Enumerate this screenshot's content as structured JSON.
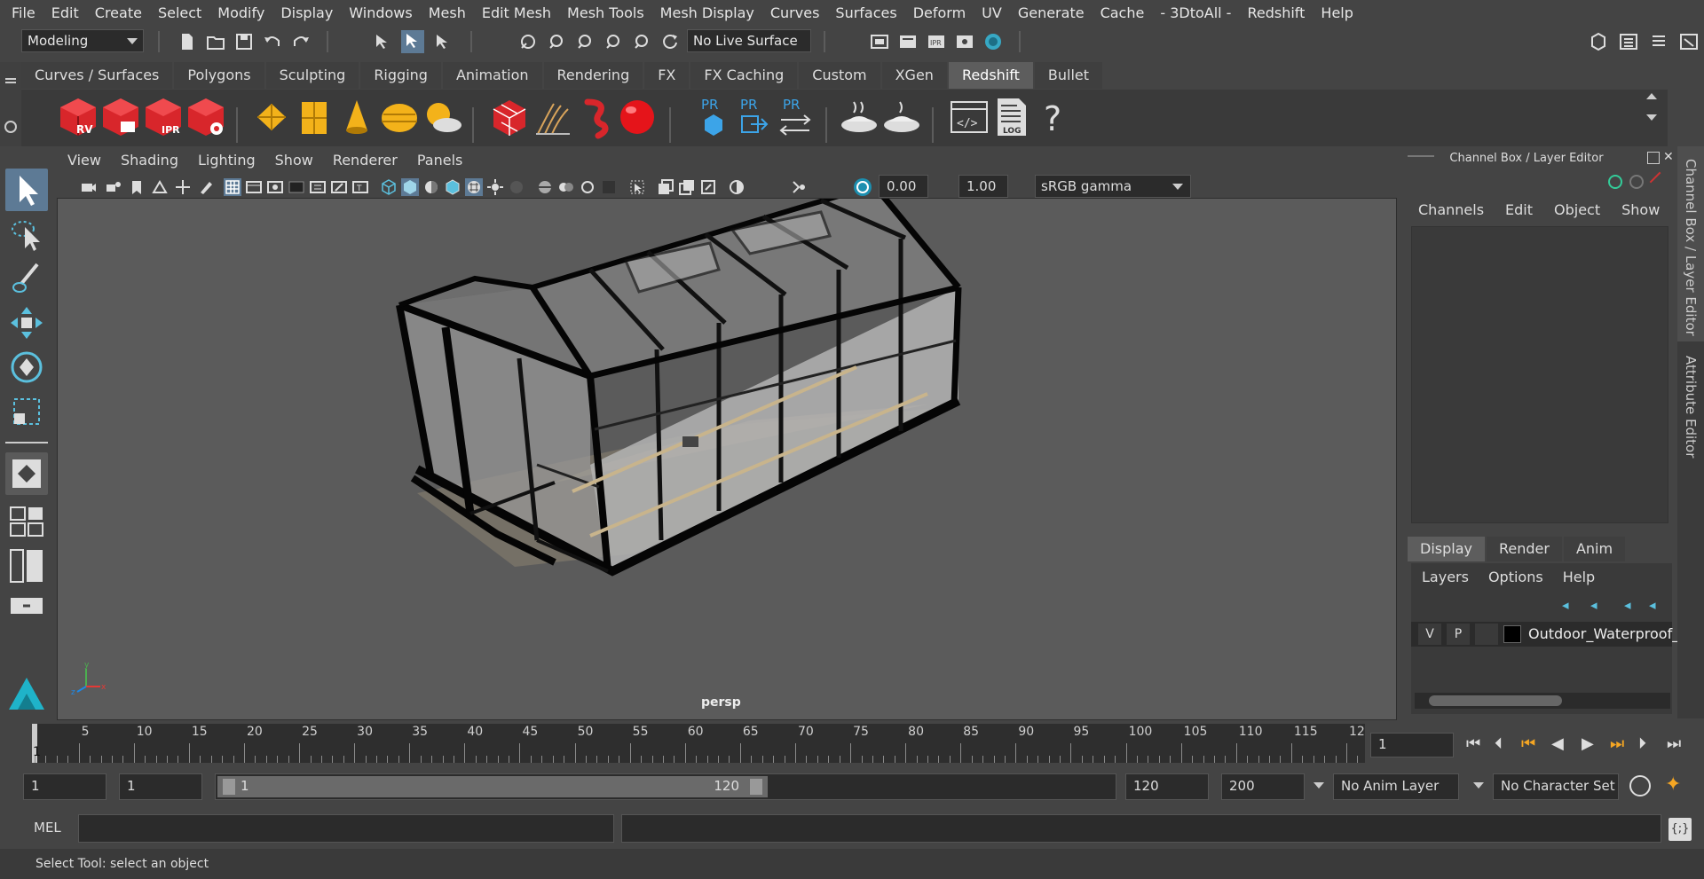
{
  "menubar": [
    "File",
    "Edit",
    "Create",
    "Select",
    "Modify",
    "Display",
    "Windows",
    "Mesh",
    "Edit Mesh",
    "Mesh Tools",
    "Mesh Display",
    "Curves",
    "Surfaces",
    "Deform",
    "UV",
    "Generate",
    "Cache",
    "- 3DtoAll -",
    "Redshift",
    "Help"
  ],
  "status": {
    "mode": "Modeling",
    "live_surface": "No Live Surface"
  },
  "shelf_tabs": [
    "Curves / Surfaces",
    "Polygons",
    "Sculpting",
    "Rigging",
    "Animation",
    "Rendering",
    "FX",
    "FX Caching",
    "Custom",
    "XGen",
    "Redshift",
    "Bullet"
  ],
  "shelf_active": "Redshift",
  "shelf_icons": {
    "rv": "RV",
    "ipr": "IPR",
    "pr1": "PR",
    "pr2": "PR",
    "pr3": "PR",
    "log": "LOG",
    "help": "?"
  },
  "viewport": {
    "menu": [
      "View",
      "Shading",
      "Lighting",
      "Show",
      "Renderer",
      "Panels"
    ],
    "exposure": "0.00",
    "gamma": "1.00",
    "colorspace": "sRGB gamma",
    "camera": "persp",
    "axis_x": "x",
    "axis_y": "y",
    "axis_z": "z"
  },
  "channel_box": {
    "title": "Channel Box / Layer Editor",
    "menu": [
      "Channels",
      "Edit",
      "Object",
      "Show"
    ],
    "tabs": [
      "Display",
      "Render",
      "Anim"
    ],
    "layer_menu": [
      "Layers",
      "Options",
      "Help"
    ],
    "layer": {
      "v": "V",
      "p": "P",
      "name": "Outdoor_Waterproof_"
    }
  },
  "side_tabs": [
    "Channel Box / Layer Editor",
    "Attribute Editor"
  ],
  "timeline": {
    "labels": [
      "5",
      "10",
      "15",
      "20",
      "25",
      "30",
      "35",
      "40",
      "45",
      "50",
      "55",
      "60",
      "65",
      "70",
      "75",
      "80",
      "85",
      "90",
      "95",
      "100",
      "105",
      "110",
      "115",
      "12"
    ],
    "current_frame_marker": "1",
    "current_frame_field": "1"
  },
  "range": {
    "start": "1",
    "playback_start": "1",
    "slider_start": "1",
    "slider_end": "120",
    "playback_end": "120",
    "end": "200",
    "anim_layer": "No Anim Layer",
    "char_set": "No Character Set"
  },
  "mel": {
    "label": "MEL"
  },
  "help_line": "Select Tool: select an object"
}
